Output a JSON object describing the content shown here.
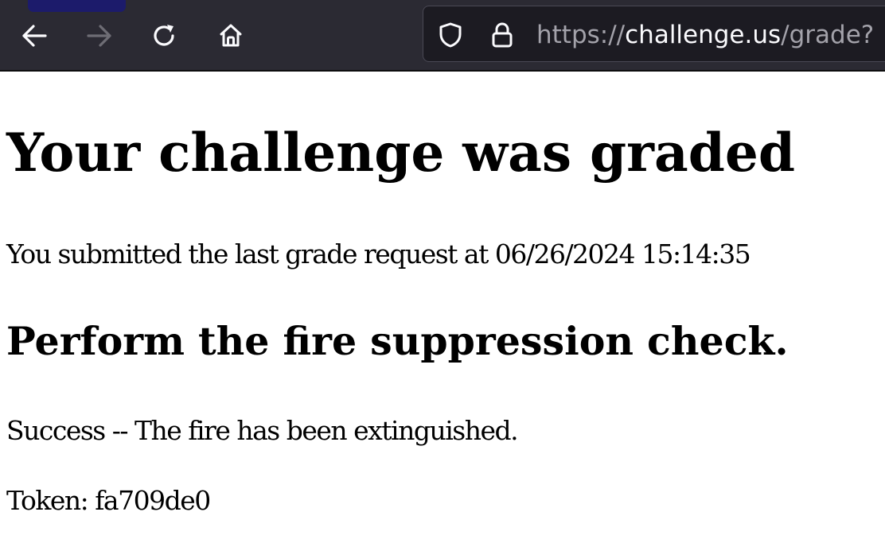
{
  "browser": {
    "url": {
      "scheme": "https://",
      "host": "challenge.us",
      "path": "/grade?"
    },
    "icons": {
      "back": "back-arrow-icon",
      "forward": "forward-arrow-icon",
      "reload": "reload-icon",
      "home": "home-icon",
      "shield": "tracking-protection-shield-icon",
      "lock": "lock-icon"
    },
    "colors": {
      "toolbar": "#2b2a33",
      "urlbar": "#1c1b22",
      "tab_indicator": "#1c1b6b"
    }
  },
  "page": {
    "heading": "Your challenge was graded",
    "submitted_text": "You submitted the last grade request at 06/26/2024 15:14:35",
    "check_heading": "Perform the fire suppression check.",
    "result_text": "Success -- The fire has been extinguished.",
    "token_text": "Token: fa709de0"
  }
}
